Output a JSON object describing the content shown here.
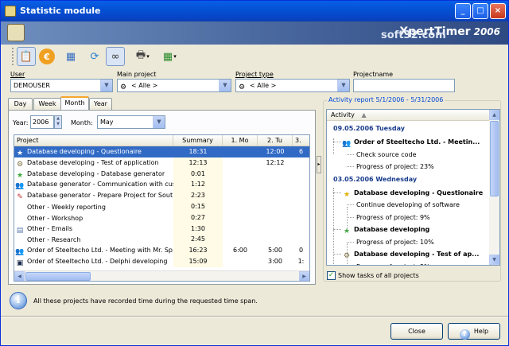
{
  "window": {
    "title": "Statistic module",
    "controls": {
      "minimize": "_",
      "maximize": "□",
      "close": "×"
    }
  },
  "banner": {
    "brand": "XpertTimer",
    "year": "2006",
    "watermark": "soft32.com"
  },
  "toolbar": {
    "items": [
      {
        "name": "report-view-icon",
        "glyph": "📋",
        "active": true
      },
      {
        "name": "currency-icon",
        "glyph": "€",
        "active": false
      },
      {
        "name": "calendar-icon",
        "glyph": "▦",
        "active": false
      },
      {
        "name": "refresh-icon",
        "glyph": "⟳",
        "active": false
      },
      {
        "name": "binoculars-icon",
        "glyph": "∞",
        "active": true
      },
      {
        "name": "printer-icon",
        "glyph": "🖶",
        "active": false,
        "dropdown": true
      },
      {
        "name": "export-icon",
        "glyph": "▦",
        "active": false,
        "dropdown": true
      }
    ]
  },
  "filters": {
    "user": {
      "label": "User",
      "value": "DEMOUSER"
    },
    "main_project": {
      "label": "Main project",
      "value": "< Alle >"
    },
    "project_type": {
      "label": "Project type",
      "value": "< Alle >"
    },
    "project_name": {
      "label": "Projectname",
      "value": ""
    }
  },
  "tabs": [
    "Day",
    "Week",
    "Month",
    "Year"
  ],
  "selected_tab": "Month",
  "period": {
    "year_label": "Year:",
    "year_value": "2006",
    "month_label": "Month:",
    "month_value": "May"
  },
  "grid": {
    "columns": [
      "Project",
      "Summary",
      "1. Mo",
      "2. Tu",
      "3."
    ],
    "rows": [
      {
        "icon": "★",
        "icon_color": "#8a8a8a",
        "project": "Database developing - Questionaire",
        "summary": "18:31",
        "d1": "",
        "d2": "12:00",
        "d3": "6",
        "selected": true
      },
      {
        "icon": "⚙",
        "icon_color": "#7a6a3a",
        "project": "Database developing - Test of application",
        "summary": "12:13",
        "d1": "",
        "d2": "12:12",
        "d3": ""
      },
      {
        "icon": "★",
        "icon_color": "#3aa83a",
        "project": "Database developing - Database generator",
        "summary": "0:01",
        "d1": "",
        "d2": "",
        "d3": ""
      },
      {
        "icon": "👥",
        "icon_color": "#b05a1a",
        "project": "Database generator - Communication with cus...",
        "summary": "1:12",
        "d1": "",
        "d2": "",
        "d3": ""
      },
      {
        "icon": "✎",
        "icon_color": "#c03030",
        "project": "Database generator - Prepare Project for Sout...",
        "summary": "2:23",
        "d1": "",
        "d2": "",
        "d3": ""
      },
      {
        "icon": "",
        "icon_color": "#000",
        "project": "Other - Weekly reporting",
        "summary": "0:15",
        "d1": "",
        "d2": "",
        "d3": ""
      },
      {
        "icon": "",
        "icon_color": "#000",
        "project": "Other - Workshop",
        "summary": "0:27",
        "d1": "",
        "d2": "",
        "d3": ""
      },
      {
        "icon": "▤",
        "icon_color": "#5a7ab0",
        "project": "Other - Emails",
        "summary": "1:30",
        "d1": "",
        "d2": "",
        "d3": ""
      },
      {
        "icon": "",
        "icon_color": "#000",
        "project": "Other - Research",
        "summary": "2:45",
        "d1": "",
        "d2": "",
        "d3": ""
      },
      {
        "icon": "👥",
        "icon_color": "#b05a1a",
        "project": "Order of Steeltecho Ltd. - Meeting with Mr. Sp...",
        "summary": "16:23",
        "d1": "6:00",
        "d2": "5:00",
        "d3": "0"
      },
      {
        "icon": "▣",
        "icon_color": "#1a2a4a",
        "project": "Order of Steeltecho Ltd. - Delphi developing",
        "summary": "15:09",
        "d1": "",
        "d2": "3:00",
        "d3": "1:"
      }
    ]
  },
  "report": {
    "title": "Activity report 5/1/2006 - 5/31/2006",
    "column": "Activity",
    "items": [
      {
        "type": "date",
        "text": "09.05.2006 Tuesday"
      },
      {
        "type": "proj",
        "icon": "👥",
        "icon_color": "#b05a1a",
        "text": "Order of Steeltecho Ltd. - Meetin..."
      },
      {
        "type": "task",
        "text": "Check source code"
      },
      {
        "type": "task",
        "text": "Progress of project: 23%"
      },
      {
        "type": "date",
        "text": "03.05.2006 Wednesday"
      },
      {
        "type": "proj",
        "icon": "★",
        "icon_color": "#e0b000",
        "text": "Database developing - Questionaire"
      },
      {
        "type": "task",
        "text": "Continue developing of software"
      },
      {
        "type": "task",
        "text": "Progress of project: 9%"
      },
      {
        "type": "proj",
        "icon": "★",
        "icon_color": "#3aa83a",
        "text": "Database developing"
      },
      {
        "type": "task",
        "text": "Progress of project: 10%"
      },
      {
        "type": "proj",
        "icon": "⚙",
        "icon_color": "#7a6a3a",
        "text": "Database developing - Test of ap..."
      },
      {
        "type": "task",
        "text": "Progress of project: 5%"
      }
    ],
    "show_all_label": "Show tasks of all projects",
    "show_all_checked": true
  },
  "status": {
    "message": "All these projects have recorded time during the requested time span."
  },
  "buttons": {
    "close": "Close",
    "help": "Help"
  }
}
